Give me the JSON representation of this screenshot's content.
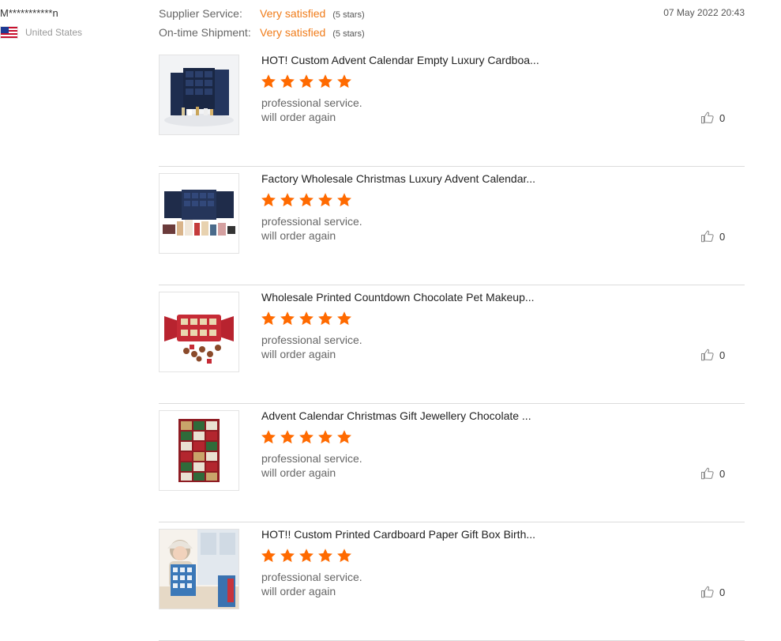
{
  "reviewer": {
    "name": "M***********n",
    "country": "United States",
    "flag_icon": "us-flag-icon"
  },
  "ratings": [
    {
      "label": "Supplier Service:",
      "value": "Very satisfied",
      "stars": "(5 stars)"
    },
    {
      "label": "On-time Shipment:",
      "value": "Very satisfied",
      "stars": "(5 stars)"
    }
  ],
  "date": "07 May 2022 20:43",
  "colors": {
    "accent": "#f07c1a",
    "star": "#ff6a00",
    "divider": "#dcdcdc"
  },
  "reviews": [
    {
      "title": "HOT! Custom Advent Calendar Empty Luxury Cardboa...",
      "rating": 5,
      "lines": [
        "professional service.",
        "will order again"
      ],
      "helpful": "0",
      "image_icon": "navy-advent-calendar-box-image"
    },
    {
      "title": "Factory Wholesale Christmas Luxury Advent Calendar...",
      "rating": 5,
      "lines": [
        "professional service.",
        "will order again"
      ],
      "helpful": "0",
      "image_icon": "cosmetics-advent-calendar-image"
    },
    {
      "title": "Wholesale Printed Countdown Chocolate Pet Makeup...",
      "rating": 5,
      "lines": [
        "professional service.",
        "will order again"
      ],
      "helpful": "0",
      "image_icon": "red-cracker-advent-box-image"
    },
    {
      "title": "Advent Calendar Christmas Gift Jewellery Chocolate ...",
      "rating": 5,
      "lines": [
        "professional service.",
        "will order again"
      ],
      "helpful": "0",
      "image_icon": "drawer-advent-calendar-image"
    },
    {
      "title": "HOT!! Custom Printed Cardboard Paper Gift Box Birth...",
      "rating": 5,
      "lines": [
        "professional service.",
        "will order again"
      ],
      "helpful": "0",
      "image_icon": "child-with-advent-calendar-image"
    }
  ]
}
